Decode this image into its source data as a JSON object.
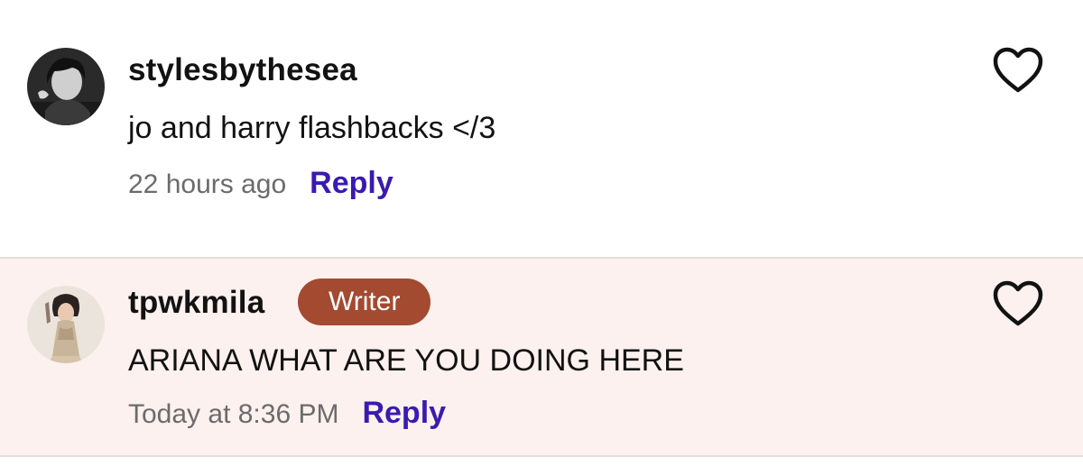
{
  "comments": [
    {
      "username": "stylesbythesea",
      "text": "jo and harry flashbacks </3",
      "timestamp": "22 hours ago",
      "reply_label": "Reply",
      "avatar_icon": "user-avatar-photo",
      "like_icon": "heart-outline-icon"
    },
    {
      "username": "tpwkmila",
      "badge": "Writer",
      "text": "ARIANA WHAT ARE YOU DOING HERE",
      "timestamp": "Today at 8:36 PM",
      "reply_label": "Reply",
      "avatar_icon": "user-avatar-photo",
      "like_icon": "heart-outline-icon"
    }
  ],
  "colors": {
    "reply_link": "#3a1ab0",
    "writer_badge": "#a34a30",
    "highlight_background": "#fcf1ee"
  }
}
